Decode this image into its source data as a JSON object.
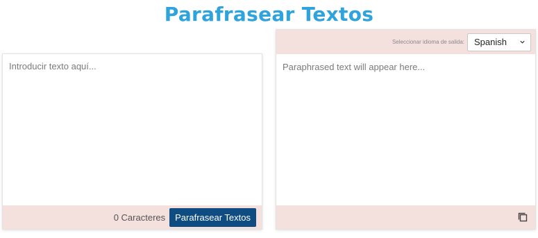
{
  "page": {
    "title": "Parafrasear Textos"
  },
  "input_panel": {
    "placeholder": "Introducir texto aquí...",
    "char_count": "0 Caracteres",
    "button_label": "Parafrasear Textos"
  },
  "output_panel": {
    "language_label": "Seleccionar idioma de salida:",
    "language_selected": "Spanish",
    "placeholder": "Paraphrased text will appear here...",
    "copy_icon": "copy-icon"
  },
  "colors": {
    "title": "#2ea3dc",
    "bar_background": "#f4e0dd",
    "button_background": "#0f4c81"
  }
}
